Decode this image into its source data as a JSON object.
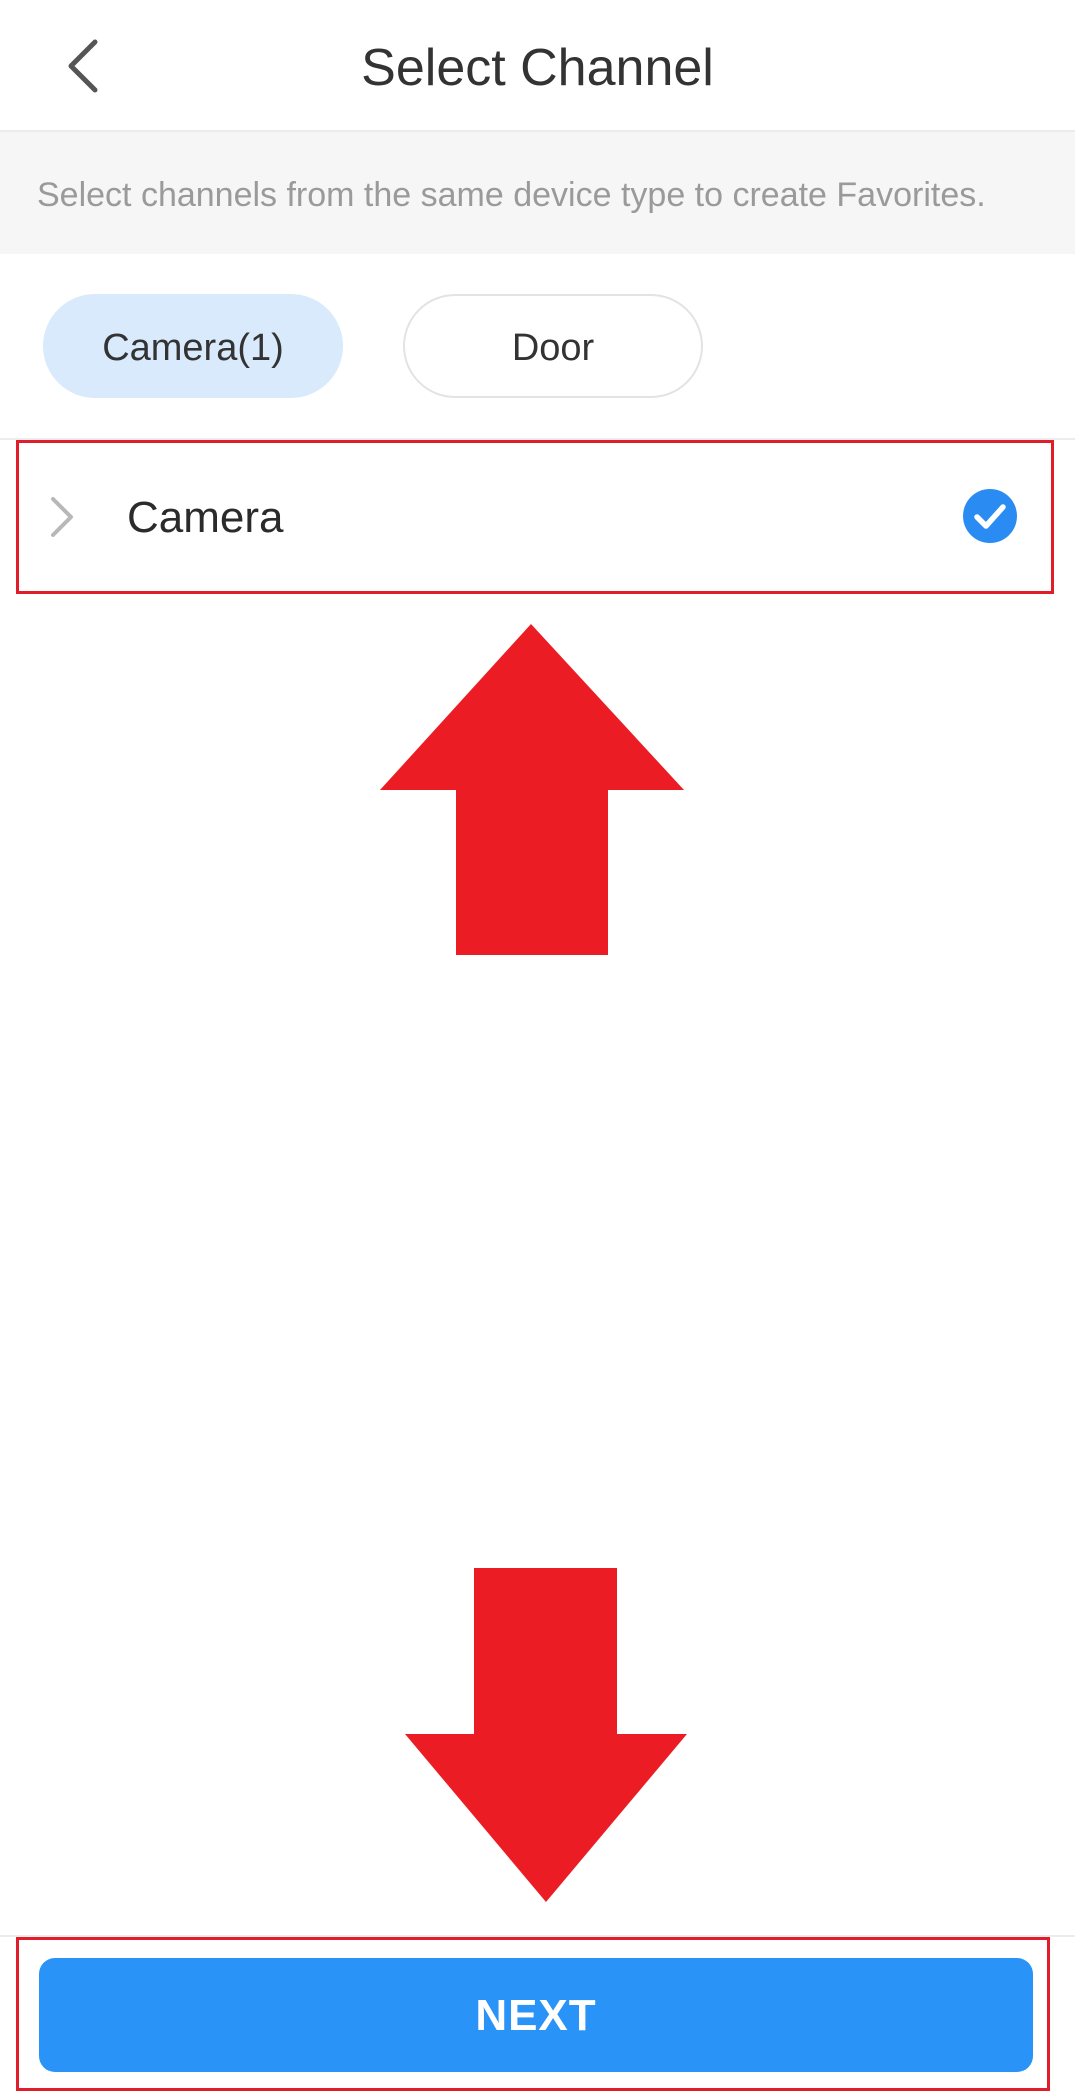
{
  "header": {
    "title": "Select Channel",
    "back_icon": "chevron-left-icon"
  },
  "hint": {
    "text": "Select channels from the same device type to create Favorites."
  },
  "filters": {
    "items": [
      {
        "label": "Camera(1)",
        "selected": true
      },
      {
        "label": "Door",
        "selected": false
      }
    ],
    "selected_color": "#d9eafc"
  },
  "channel_list": {
    "items": [
      {
        "label": "Camera",
        "checked": true,
        "expand_icon": "chevron-right-icon",
        "check_icon": "checkmark-circle-icon"
      }
    ]
  },
  "footer": {
    "next_label": "NEXT",
    "button_color": "#2a93f7"
  },
  "annotations": {
    "arrow_color": "#ec1c24",
    "highlight_color": "#e01e2b"
  }
}
